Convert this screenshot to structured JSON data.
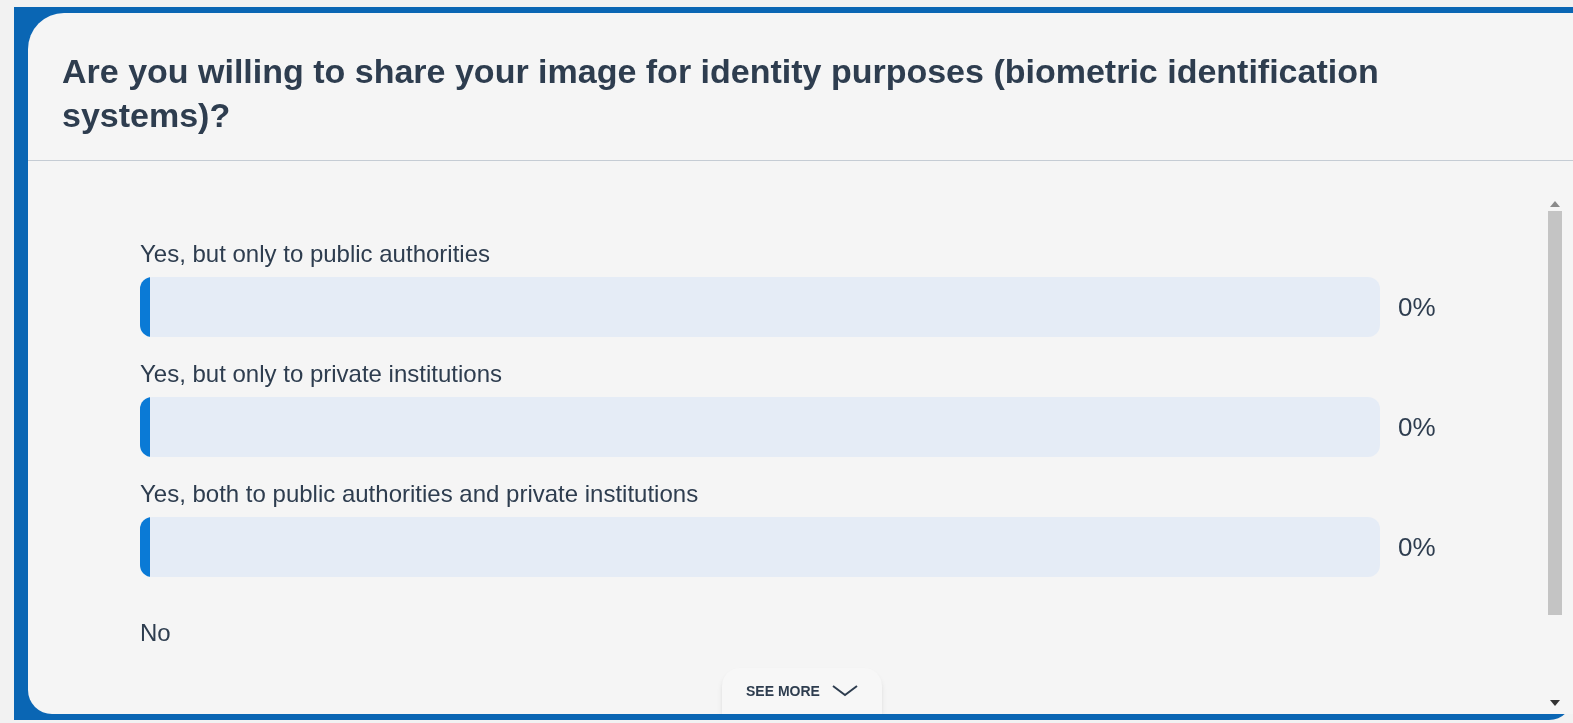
{
  "question": "Are you willing to share your image for identity purposes (biometric identification systems)?",
  "options": [
    {
      "label": "Yes, but only to public authorities",
      "level": 0,
      "percent": "0%"
    },
    {
      "label": "Yes, but only to private institutions",
      "level": 0,
      "percent": "0%"
    },
    {
      "label": "Yes, both to public authorities and private institutions",
      "level": 0,
      "percent": "0%"
    }
  ],
  "partial_option": "No",
  "see_more": "SEE MORE"
}
